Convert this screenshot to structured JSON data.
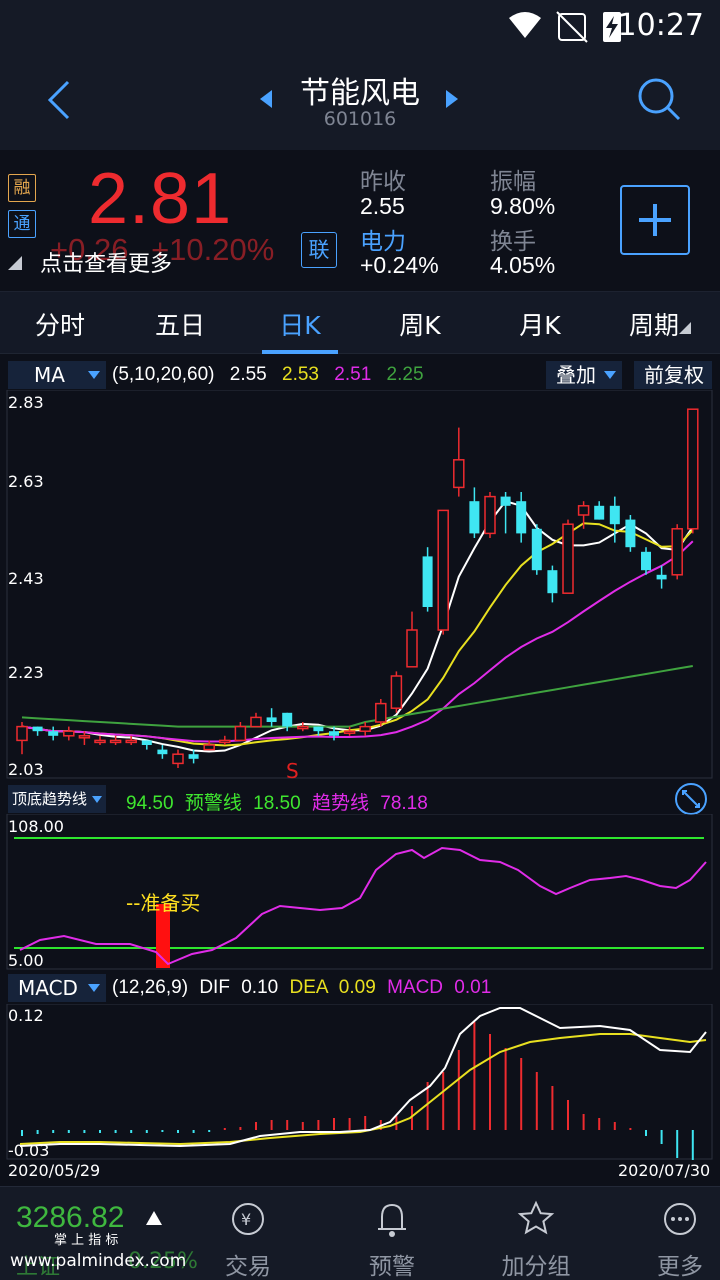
{
  "status": {
    "time": "10:27"
  },
  "nav": {
    "title": "节能风电",
    "code": "601016"
  },
  "quote": {
    "tag1": "融",
    "tag2": "通",
    "price": "2.81",
    "change": "+0.26",
    "change_pct": "+10.20%",
    "tip": "点击查看更多",
    "lian": "联",
    "stats": [
      {
        "label": "昨收",
        "value": "2.55"
      },
      {
        "label": "振幅",
        "value": "9.80%"
      },
      {
        "label": "电力",
        "value": "+0.24%"
      },
      {
        "label": "换手",
        "value": "4.05%"
      }
    ]
  },
  "tabs": [
    "分时",
    "五日",
    "日K",
    "周K",
    "月K",
    "周期"
  ],
  "ma_bar": {
    "select": "MA",
    "params": "(5,10,20,60)",
    "v5": "2.55",
    "v10": "2.53",
    "v20": "2.51",
    "v60": "2.25",
    "overlay": "叠加",
    "adjust": "前复权"
  },
  "main_chart": {
    "y_ticks": [
      "2.83",
      "2.63",
      "2.43",
      "2.23",
      "2.03"
    ],
    "sell_marker": "S"
  },
  "trend_bar": {
    "select": "顶底趋势线",
    "value": "94.50",
    "warn_label": "预警线",
    "warn_value": "18.50",
    "trend_label": "趋势线",
    "trend_value": "78.18"
  },
  "trend_chart": {
    "top": "108.00",
    "bottom": "5.00",
    "signal": "--准备买"
  },
  "macd_bar": {
    "select": "MACD",
    "params": "(12,26,9)",
    "dif_label": "DIF",
    "dif": "0.10",
    "dea_label": "DEA",
    "dea": "0.09",
    "macd_label": "MACD",
    "macd": "0.01"
  },
  "macd_chart": {
    "top": "0.12",
    "bottom": "-0.03",
    "date_start": "2020/05/29",
    "date_end": "2020/07/30"
  },
  "bottom_nav": {
    "index_value": "3286.82",
    "index_name": "上证",
    "index_pct": "0.25%",
    "watermark1": "掌 上 指 标",
    "watermark2": "www.palmindex.com",
    "items": [
      "交易",
      "预警",
      "加分组",
      "更多"
    ]
  },
  "colors": {
    "up": "#ee2b2f",
    "down": "#3fe6f2",
    "accent": "#4aa2ff",
    "ma5": "#ffffff",
    "ma10": "#e8e020",
    "ma20": "#e02ce8",
    "ma60": "#3fa33f"
  },
  "chart_data": {
    "type": "candlestick",
    "y_axis_ticks": [
      2.83,
      2.63,
      2.43,
      2.23,
      2.03
    ],
    "ylim": [
      2.03,
      2.83
    ],
    "series_names": [
      "MA5",
      "MA10",
      "MA20",
      "MA60"
    ],
    "last_values": {
      "MA5": 2.55,
      "MA10": 2.53,
      "MA20": 2.51,
      "MA60": 2.25
    },
    "candles": [
      [
        2.09,
        2.12,
        2.13,
        2.06
      ],
      [
        2.12,
        2.11,
        2.12,
        2.1
      ],
      [
        2.11,
        2.1,
        2.12,
        2.09
      ],
      [
        2.1,
        2.11,
        2.12,
        2.09
      ],
      [
        2.1,
        2.1,
        2.11,
        2.08
      ],
      [
        2.09,
        2.09,
        2.1,
        2.08
      ],
      [
        2.09,
        2.09,
        2.1,
        2.08
      ],
      [
        2.09,
        2.09,
        2.1,
        2.08
      ],
      [
        2.09,
        2.08,
        2.09,
        2.07
      ],
      [
        2.07,
        2.06,
        2.08,
        2.05
      ],
      [
        2.04,
        2.06,
        2.07,
        2.03
      ],
      [
        2.06,
        2.05,
        2.07,
        2.04
      ],
      [
        2.07,
        2.08,
        2.09,
        2.07
      ],
      [
        2.09,
        2.09,
        2.1,
        2.08
      ],
      [
        2.09,
        2.12,
        2.13,
        2.09
      ],
      [
        2.12,
        2.14,
        2.15,
        2.12
      ],
      [
        2.14,
        2.13,
        2.16,
        2.12
      ],
      [
        2.15,
        2.12,
        2.15,
        2.11
      ],
      [
        2.12,
        2.12,
        2.13,
        2.11
      ],
      [
        2.12,
        2.11,
        2.12,
        2.1
      ],
      [
        2.11,
        2.1,
        2.12,
        2.09
      ],
      [
        2.11,
        2.11,
        2.12,
        2.1
      ],
      [
        2.11,
        2.12,
        2.13,
        2.1
      ],
      [
        2.13,
        2.17,
        2.18,
        2.12
      ],
      [
        2.16,
        2.23,
        2.24,
        2.15
      ],
      [
        2.25,
        2.33,
        2.37,
        2.25
      ],
      [
        2.49,
        2.38,
        2.51,
        2.37
      ],
      [
        2.33,
        2.59,
        2.59,
        2.32
      ],
      [
        2.64,
        2.7,
        2.77,
        2.62
      ],
      [
        2.61,
        2.54,
        2.64,
        2.53
      ],
      [
        2.54,
        2.62,
        2.63,
        2.53
      ],
      [
        2.62,
        2.6,
        2.63,
        2.54
      ],
      [
        2.61,
        2.54,
        2.63,
        2.52
      ],
      [
        2.55,
        2.46,
        2.56,
        2.45
      ],
      [
        2.46,
        2.41,
        2.47,
        2.39
      ],
      [
        2.41,
        2.56,
        2.57,
        2.41
      ],
      [
        2.58,
        2.6,
        2.61,
        2.55
      ],
      [
        2.6,
        2.57,
        2.61,
        2.57
      ],
      [
        2.6,
        2.56,
        2.62,
        2.52
      ],
      [
        2.57,
        2.51,
        2.58,
        2.5
      ],
      [
        2.5,
        2.46,
        2.51,
        2.45
      ],
      [
        2.45,
        2.44,
        2.47,
        2.42
      ],
      [
        2.45,
        2.55,
        2.56,
        2.44
      ],
      [
        2.55,
        2.81,
        2.81,
        2.54
      ]
    ]
  }
}
